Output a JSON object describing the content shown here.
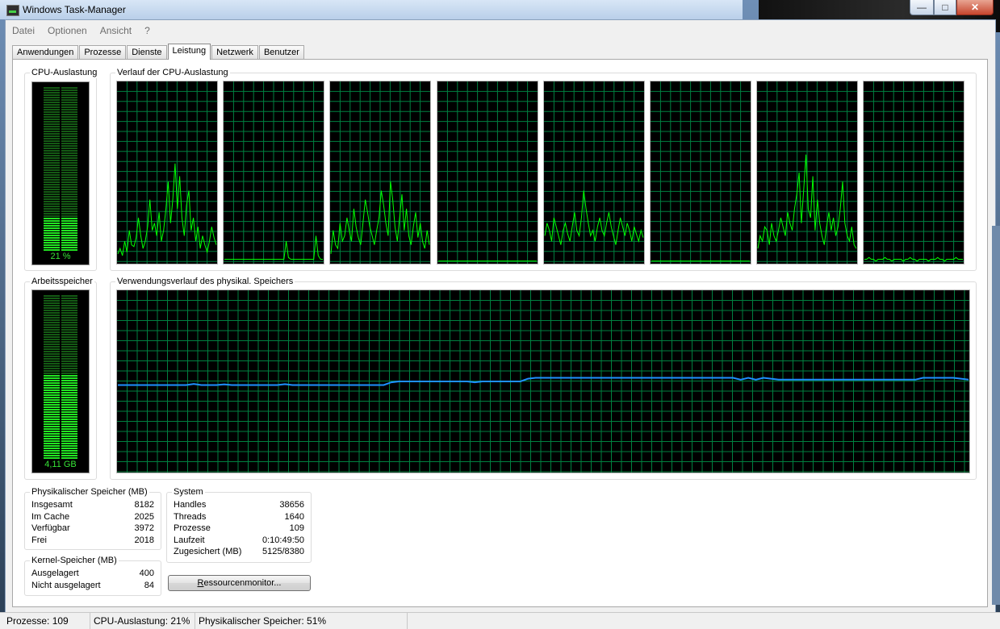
{
  "window": {
    "title": "Windows Task-Manager"
  },
  "menu": [
    "Datei",
    "Optionen",
    "Ansicht",
    "?"
  ],
  "tabs": [
    {
      "label": "Anwendungen",
      "active": false
    },
    {
      "label": "Prozesse",
      "active": false
    },
    {
      "label": "Dienste",
      "active": false
    },
    {
      "label": "Leistung",
      "active": true
    },
    {
      "label": "Netzwerk",
      "active": false
    },
    {
      "label": "Benutzer",
      "active": false
    }
  ],
  "cpu": {
    "group_label": "CPU-Auslastung",
    "value_label": "21 %",
    "percent": 21,
    "history_label": "Verlauf der CPU-Auslastung"
  },
  "cpu_history": [
    [
      5,
      8,
      4,
      12,
      6,
      18,
      10,
      9,
      14,
      25,
      15,
      8,
      12,
      20,
      35,
      18,
      22,
      15,
      28,
      12,
      18,
      30,
      45,
      22,
      35,
      55,
      30,
      48,
      25,
      15,
      32,
      40,
      18,
      25,
      12,
      20,
      8,
      15,
      10,
      6,
      12,
      20,
      14,
      10
    ],
    [
      2,
      2,
      2,
      2,
      2,
      2,
      2,
      2,
      2,
      2,
      2,
      2,
      2,
      2,
      2,
      2,
      2,
      2,
      2,
      2,
      2,
      2,
      2,
      2,
      2,
      2,
      2,
      12,
      3,
      2,
      2,
      2,
      2,
      2,
      2,
      2,
      2,
      2,
      2,
      2,
      15,
      4,
      2,
      2
    ],
    [
      5,
      18,
      10,
      8,
      22,
      12,
      15,
      25,
      18,
      12,
      30,
      20,
      14,
      10,
      22,
      35,
      28,
      20,
      15,
      10,
      18,
      25,
      40,
      32,
      22,
      15,
      45,
      35,
      20,
      12,
      25,
      38,
      18,
      30,
      15,
      10,
      20,
      28,
      14,
      22,
      12,
      8,
      18,
      10
    ],
    [
      1,
      1,
      1,
      1,
      1,
      1,
      1,
      1,
      1,
      1,
      1,
      1,
      1,
      1,
      1,
      1,
      1,
      1,
      1,
      1,
      1,
      1,
      1,
      1,
      1,
      1,
      1,
      1,
      1,
      1,
      1,
      1,
      1,
      1,
      1,
      1,
      1,
      1,
      1,
      1,
      1,
      1,
      1,
      1
    ],
    [
      15,
      22,
      18,
      12,
      25,
      20,
      15,
      10,
      18,
      22,
      16,
      12,
      20,
      28,
      18,
      15,
      25,
      40,
      30,
      22,
      15,
      18,
      12,
      20,
      25,
      18,
      15,
      22,
      28,
      20,
      15,
      10,
      18,
      25,
      20,
      15,
      22,
      18,
      12,
      20,
      16,
      12,
      18,
      14
    ],
    [
      1,
      1,
      1,
      1,
      1,
      1,
      1,
      1,
      1,
      1,
      1,
      1,
      1,
      1,
      1,
      1,
      1,
      1,
      1,
      1,
      1,
      1,
      1,
      1,
      1,
      1,
      1,
      1,
      1,
      1,
      1,
      1,
      1,
      1,
      1,
      1,
      1,
      1,
      1,
      1,
      1,
      1,
      1,
      1
    ],
    [
      8,
      15,
      12,
      20,
      18,
      10,
      22,
      15,
      12,
      18,
      25,
      20,
      15,
      28,
      22,
      18,
      30,
      38,
      50,
      22,
      40,
      60,
      30,
      25,
      48,
      18,
      35,
      22,
      15,
      10,
      20,
      28,
      18,
      25,
      15,
      20,
      30,
      45,
      22,
      15,
      12,
      20,
      10,
      8
    ],
    [
      2,
      2,
      3,
      2,
      2,
      1,
      2,
      2,
      2,
      3,
      2,
      2,
      1,
      2,
      2,
      2,
      2,
      1,
      2,
      2,
      3,
      2,
      2,
      1,
      2,
      2,
      2,
      2,
      1,
      2,
      2,
      2,
      3,
      2,
      2,
      1,
      2,
      2,
      2,
      2,
      3,
      2,
      2,
      2
    ]
  ],
  "memory": {
    "group_label": "Arbeitsspeicher",
    "value_label": "4,11 GB",
    "percent": 51,
    "history_label": "Verwendungsverlauf des physikal. Speichers",
    "history": [
      48,
      48,
      48,
      48,
      48,
      48,
      48,
      48,
      48,
      48,
      48.6,
      48,
      48,
      48,
      48.4,
      48,
      48,
      48,
      48,
      48,
      48,
      48,
      48.5,
      48,
      48,
      48,
      48,
      48,
      48,
      48,
      48,
      48,
      48,
      48,
      48,
      48,
      49.5,
      50,
      50,
      50,
      50,
      50,
      50,
      50,
      50,
      50,
      50,
      49.5,
      50,
      50,
      50,
      50,
      50,
      50,
      51.5,
      52,
      52,
      52,
      52,
      52,
      52,
      52,
      52,
      52,
      52,
      52,
      52,
      52,
      52,
      52,
      52,
      52,
      52,
      52,
      52,
      52,
      52,
      52,
      52,
      52,
      52,
      52,
      51,
      52,
      51,
      52,
      51.5,
      51,
      51,
      51,
      51,
      51,
      51,
      51,
      51,
      51,
      51,
      51,
      51,
      51,
      51,
      51,
      51,
      51,
      51,
      51,
      52,
      52,
      52,
      52,
      52,
      51.5,
      51
    ]
  },
  "phys_mem": {
    "title": "Physikalischer Speicher (MB)",
    "rows": [
      {
        "label": "Insgesamt",
        "value": "8182"
      },
      {
        "label": "Im Cache",
        "value": "2025"
      },
      {
        "label": "Verfügbar",
        "value": "3972"
      },
      {
        "label": "Frei",
        "value": "2018"
      }
    ]
  },
  "kernel_mem": {
    "title": "Kernel-Speicher (MB)",
    "rows": [
      {
        "label": "Ausgelagert",
        "value": "400"
      },
      {
        "label": "Nicht ausgelagert",
        "value": "84"
      }
    ]
  },
  "system": {
    "title": "System",
    "rows": [
      {
        "label": "Handles",
        "value": "38656"
      },
      {
        "label": "Threads",
        "value": "1640"
      },
      {
        "label": "Prozesse",
        "value": "109"
      },
      {
        "label": "Laufzeit",
        "value": "0:10:49:50"
      },
      {
        "label": "Zugesichert (MB)",
        "value": "5125/8380"
      }
    ]
  },
  "resource_button": {
    "accel": "R",
    "rest": "essourcenmonitor..."
  },
  "status": {
    "processes": "Prozesse: 109",
    "cpu": "CPU-Auslastung: 21%",
    "memory": "Physikalischer Speicher: 51%"
  },
  "colors": {
    "graph_bg": "#000000",
    "grid": "#008040",
    "cpu_line": "#00ff00",
    "mem_line": "#1e90ff",
    "meter_on": "#22e522",
    "meter_off": "#145a14"
  }
}
